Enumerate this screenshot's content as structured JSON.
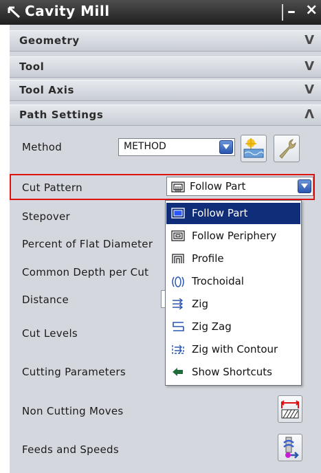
{
  "window": {
    "title": "Cavity Mill",
    "minimize": "–",
    "close": "×"
  },
  "sections": [
    {
      "label": "Geometry",
      "expanded": false
    },
    {
      "label": "Tool",
      "expanded": false
    },
    {
      "label": "Tool Axis",
      "expanded": false
    },
    {
      "label": "Path Settings",
      "expanded": true
    }
  ],
  "path_settings": {
    "method_label": "Method",
    "method_value": "METHOD",
    "cut_pattern_label": "Cut Pattern",
    "cut_pattern_value": "Follow Part",
    "rows": [
      "Stepover",
      "Percent of Flat Diameter",
      "Common Depth per Cut",
      "Distance",
      "Cut Levels",
      "Cutting Parameters",
      "Non Cutting Moves",
      "Feeds and Speeds"
    ]
  },
  "cut_pattern_options": [
    {
      "label": "Follow Part",
      "icon": "follow-part-icon",
      "selected": true
    },
    {
      "label": "Follow Periphery",
      "icon": "follow-periphery-icon",
      "selected": false
    },
    {
      "label": "Profile",
      "icon": "profile-icon",
      "selected": false
    },
    {
      "label": "Trochoidal",
      "icon": "trochoidal-icon",
      "selected": false
    },
    {
      "label": "Zig",
      "icon": "zig-icon",
      "selected": false
    },
    {
      "label": "Zig Zag",
      "icon": "zig-zag-icon",
      "selected": false
    },
    {
      "label": "Zig with Contour",
      "icon": "zig-with-contour-icon",
      "selected": false
    },
    {
      "label": "Show Shortcuts",
      "icon": "show-shortcuts-icon",
      "selected": false
    }
  ],
  "colors": {
    "highlight": "#e01010",
    "selection": "#0f2d78",
    "panel": "#d4d8de"
  }
}
